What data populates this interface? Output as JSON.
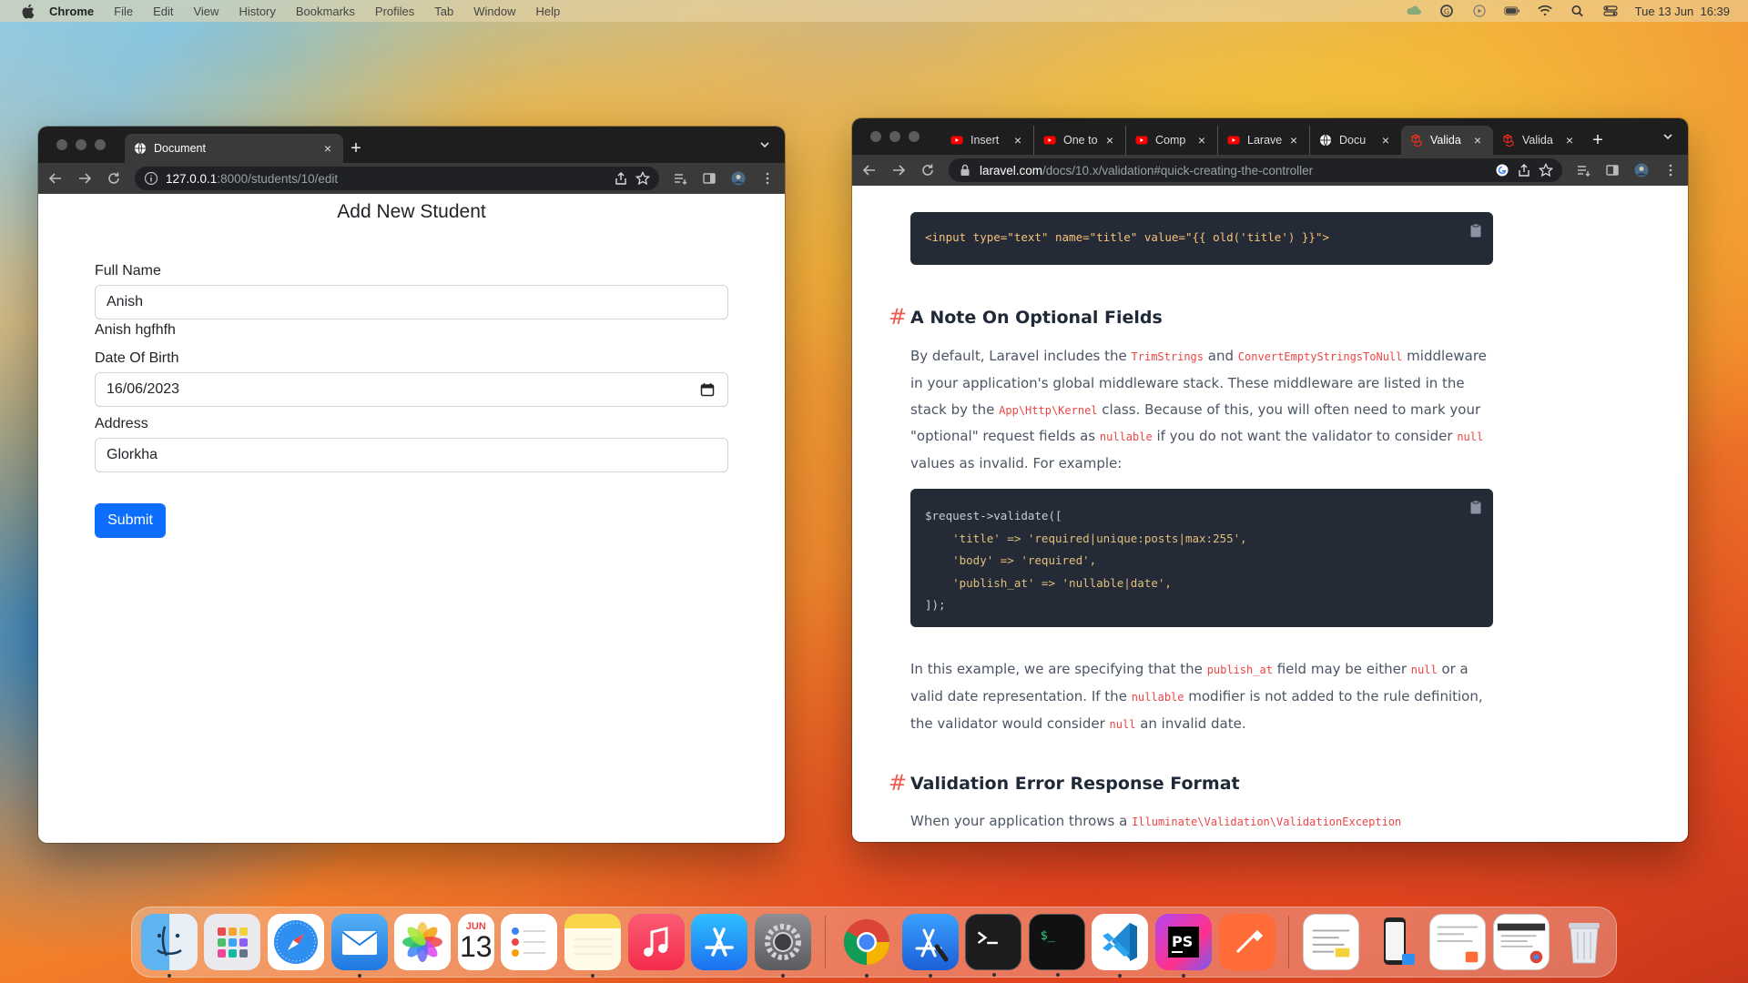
{
  "menubar": {
    "app": "Chrome",
    "items": [
      "File",
      "Edit",
      "View",
      "History",
      "Bookmarks",
      "Profiles",
      "Tab",
      "Window",
      "Help"
    ],
    "clock": "Tue 13 Jun  16:39"
  },
  "left_window": {
    "tab": {
      "title": "Document"
    },
    "url": {
      "host": "127.0.0.1",
      "path": ":8000/students/10/edit"
    },
    "page": {
      "title": "Add New Student",
      "full_name_label": "Full Name",
      "full_name_value": "Anish",
      "full_name_text": "Anish hgfhfh",
      "dob_label": "Date Of Birth",
      "dob_value": "16/06/2023",
      "address_label": "Address",
      "address_value": "Glorkha",
      "submit_label": "Submit"
    }
  },
  "right_window": {
    "tabs": [
      {
        "title": "Insert",
        "icon": "youtube-icon"
      },
      {
        "title": "One to",
        "icon": "youtube-icon"
      },
      {
        "title": "Comp",
        "icon": "youtube-icon"
      },
      {
        "title": "Larave",
        "icon": "youtube-icon"
      },
      {
        "title": "Docu",
        "icon": "globe-icon"
      },
      {
        "title": "Valida",
        "icon": "laravel-icon",
        "active": true
      },
      {
        "title": "Valida",
        "icon": "laravel-icon"
      }
    ],
    "url": {
      "host": "laravel.com",
      "path": "/docs/10.x/validation#quick-creating-the-controller"
    },
    "doc": {
      "code1": "<input type=\"text\" name=\"title\" value=\"{{ old('title') }}\">",
      "heading1": "A Note On Optional Fields",
      "p1_a": "By default, Laravel includes the ",
      "p1_code1": "TrimStrings",
      "p1_b": " and ",
      "p1_code2": "ConvertEmptyStringsToNull",
      "p1_c": " middleware in your application's global middleware stack. These middleware are listed in the stack by the ",
      "p1_code3": "App\\Http\\Kernel",
      "p1_d": " class. Because of this, you will often need to mark your \"optional\" request fields as ",
      "p1_code4": "nullable",
      "p1_e": " if you do not want the validator to consider ",
      "p1_code5": "null",
      "p1_f": " values as invalid. For example:",
      "code2": [
        "$request->validate([",
        "    'title' => 'required|unique:posts|max:255',",
        "    'body' => 'required',",
        "    'publish_at' => 'nullable|date',",
        "]);"
      ],
      "p2_a": "In this example, we are specifying that the ",
      "p2_code1": "publish_at",
      "p2_b": " field may be either ",
      "p2_code2": "null",
      "p2_c": " or a valid date representation. If the ",
      "p2_code3": "nullable",
      "p2_d": " modifier is not added to the rule definition, the validator would consider ",
      "p2_code4": "null",
      "p2_e": " an invalid date.",
      "heading2": "Validation Error Response Format",
      "p3_a": "When your application throws a ",
      "p3_code1": "Illuminate\\Validation\\ValidationException"
    }
  },
  "dock": {
    "calendar_month": "JUN",
    "calendar_day": "13"
  },
  "colors": {
    "accent_blue": "#0d6efd",
    "laravel_red": "#ef4444",
    "chrome_dark": "#1e1e1e"
  }
}
